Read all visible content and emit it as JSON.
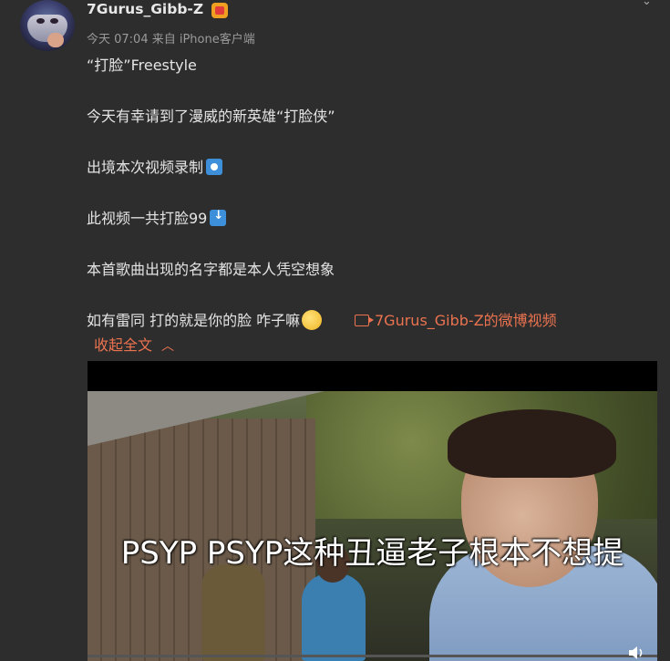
{
  "header": {
    "username": "7Gurus_Gibb-Z",
    "meta": "今天 07:04 来自 iPhone客户端"
  },
  "post": {
    "title": "“打脸”Freestyle",
    "line1": "今天有幸请到了漫威的新英雄“打脸侠”",
    "line2": "出境本次视频录制",
    "line3": "此视频一共打脸99",
    "line4": "本首歌曲出现的名字都是本人凭空想象",
    "line5": "如有雷同 打的就是你的脸 咋子嘛",
    "video_link": "7Gurus_Gibb-Z的微博视频",
    "collapse_label": "收起全文"
  },
  "video": {
    "subtitle": "PSYP PSYP这种丑逼老子根本不想提"
  },
  "icons": {
    "badge": "vip-badge-icon",
    "more": "chevron-down-icon",
    "record": "record-button-emoji",
    "down": "down-arrow-emoji",
    "face": "thinking-face-emoji",
    "camera": "video-camera-icon",
    "collapse": "chevron-up-icon",
    "volume": "volume-icon"
  },
  "colors": {
    "background": "#2d2d2d",
    "accent": "#eb7350",
    "text": "#e4e4e4",
    "meta": "#9a9a9a"
  }
}
